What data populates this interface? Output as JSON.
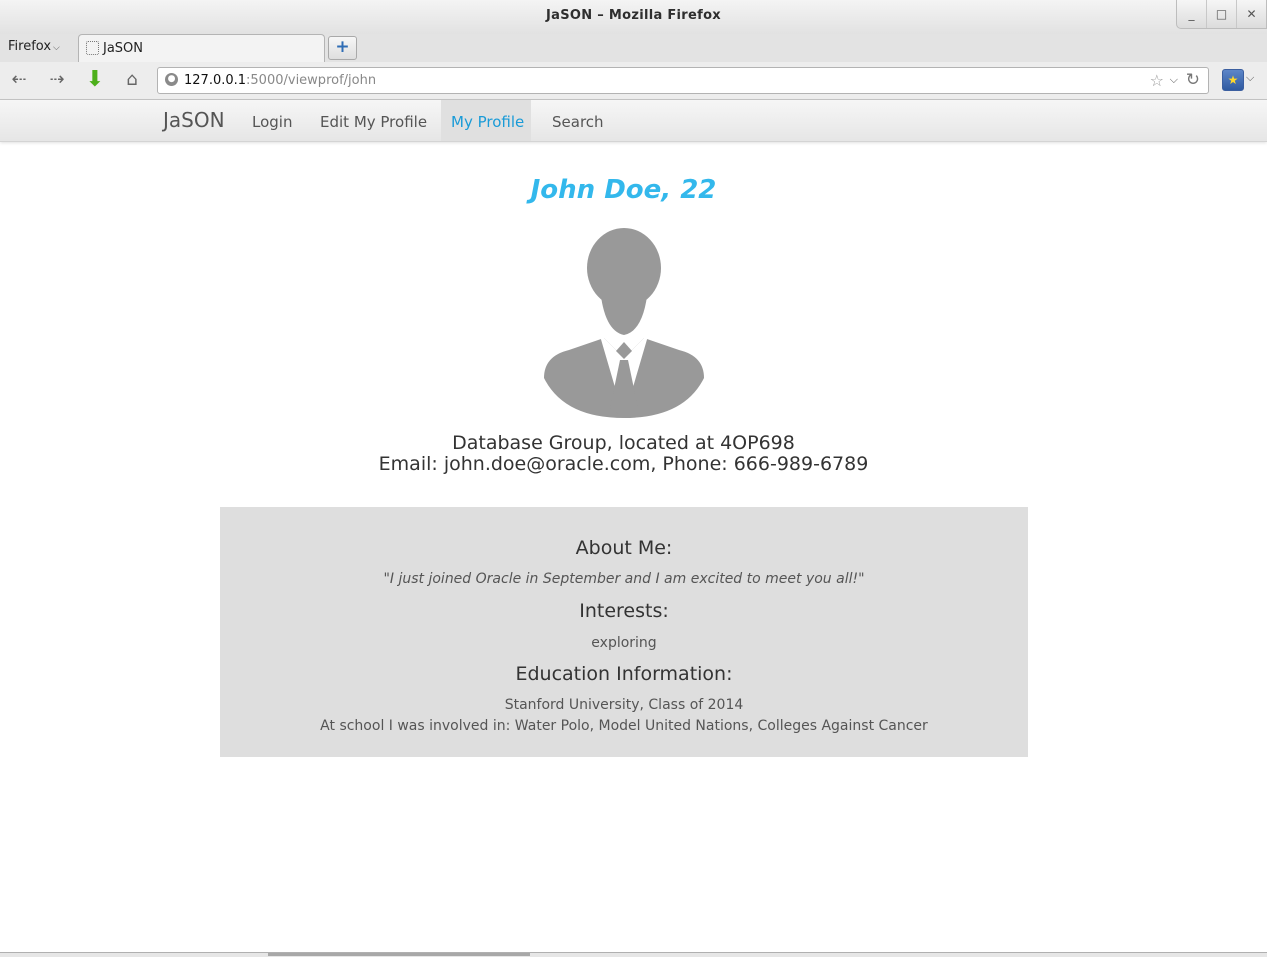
{
  "window": {
    "title": "JaSON – Mozilla Firefox",
    "buttons": {
      "minimize": "_",
      "maximize": "□",
      "close": "✕"
    }
  },
  "tabbar": {
    "menu_label": "Firefox",
    "tab_title": "JaSON",
    "new_tab_label": "+"
  },
  "navbar": {
    "url_host": "127.0.0.1",
    "url_path": ":5000/viewprof/john",
    "icons": [
      "back-icon",
      "forward-icon",
      "download-icon",
      "home-icon",
      "globe-icon",
      "star-icon",
      "reload-icon",
      "bookmarks-icon"
    ]
  },
  "site_nav": {
    "brand": "JaSON",
    "links": [
      "Login",
      "Edit My Profile",
      "My Profile",
      "Search"
    ],
    "active": "My Profile",
    "active_color": "#1a9bd7"
  },
  "profile": {
    "name_age": "John Doe, 22",
    "name_color": "#33b8ec",
    "dept_line": "Database Group, located at 4OP698",
    "contact_line": "Email: john.doe@oracle.com, Phone: 666-989-6789"
  },
  "info": {
    "about_title": "About Me:",
    "about_text": "\"I just joined Oracle in September and I am excited to meet you all!\"",
    "interests_title": "Interests:",
    "interests_text": "exploring",
    "education_title": "Education Information:",
    "education_school": "Stanford University, Class of 2014",
    "education_activities": "At school I was involved in: Water Polo, Model United Nations, Colleges Against Cancer",
    "box_color": "#dedede"
  }
}
